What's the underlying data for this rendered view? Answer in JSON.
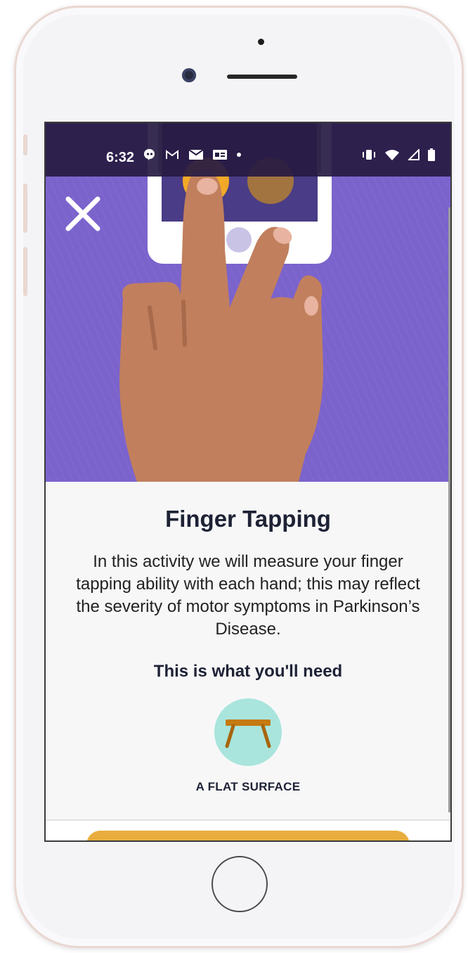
{
  "status_bar": {
    "time": "6:32",
    "left_icons": [
      "hangouts-icon",
      "gmail-icon",
      "mail-icon",
      "news-icon",
      "dot-icon"
    ],
    "right_icons": [
      "vibrate-icon",
      "wifi-icon",
      "signal-icon",
      "battery-icon"
    ]
  },
  "activity": {
    "title": "Finger Tapping",
    "description": "In this activity we will measure your finger tapping ability with each hand; this may reflect the severity of motor symptoms in Parkinson’s Disease.",
    "needs_heading": "This is what you'll need",
    "items": [
      {
        "label": "A FLAT SURFACE",
        "icon": "table-icon"
      }
    ]
  },
  "colors": {
    "hero": "#7b63cc",
    "statusbar": "#261a42",
    "accent_yellow": "#e9ad3e",
    "item_circle": "#a9e5dd",
    "skin": "#c17f5d"
  }
}
